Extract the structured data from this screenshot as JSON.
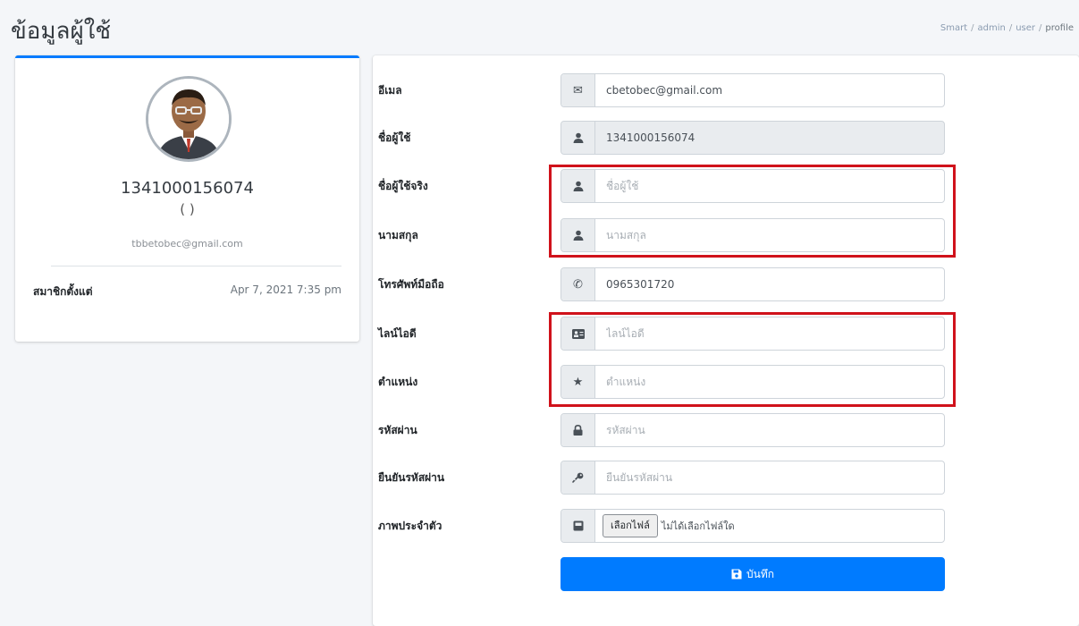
{
  "header": {
    "title": "ข้อมูลผู้ใช้",
    "breadcrumb": [
      "Smart",
      "admin",
      "user",
      "profile"
    ]
  },
  "profile": {
    "name": "1341000156074",
    "sub": "( )",
    "email": "tbbetobec@gmail.com",
    "meta_label": "สมาชิกตั้งแต่",
    "meta_value": "Apr 7, 2021 7:35 pm"
  },
  "form": {
    "email": {
      "label": "อีเมล",
      "icon": "envelope-icon",
      "value": "cbetobec@gmail.com",
      "placeholder": ""
    },
    "username": {
      "label": "ชื่อผู้ใช้",
      "icon": "user-icon",
      "value": "1341000156074",
      "placeholder": ""
    },
    "display_name": {
      "label": "ชื่อผู้ใช้จริง",
      "icon": "user-icon",
      "value": "",
      "placeholder": "ชื่อผู้ใช้"
    },
    "surname": {
      "label": "นามสกุล",
      "icon": "user-icon",
      "value": "",
      "placeholder": "นามสกุล"
    },
    "phone": {
      "label": "โทรศัพท์มือถือ",
      "icon": "phone-icon",
      "value": "0965301720",
      "placeholder": ""
    },
    "line_id": {
      "label": "ไลน์ไอดี",
      "icon": "id-card-icon",
      "value": "",
      "placeholder": "ไลน์ไอดี"
    },
    "position": {
      "label": "ตำแหน่ง",
      "icon": "star-icon",
      "value": "",
      "placeholder": "ตำแหน่ง"
    },
    "password": {
      "label": "รหัสผ่าน",
      "icon": "lock-icon",
      "value": "",
      "placeholder": "รหัสผ่าน"
    },
    "confirm_password": {
      "label": "ยืนยันรหัสผ่าน",
      "icon": "key-icon",
      "value": "",
      "placeholder": "ยืนยันรหัสผ่าน"
    },
    "photo": {
      "label": "ภาพประจำตัว",
      "icon": "image-icon",
      "button": "เลือกไฟล์",
      "status": "ไม่ได้เลือกไฟล์ใด"
    },
    "save_label": "บันทึก"
  },
  "colors": {
    "primary": "#007bff",
    "highlight": "#d0121b",
    "background": "#f4f6f9"
  }
}
